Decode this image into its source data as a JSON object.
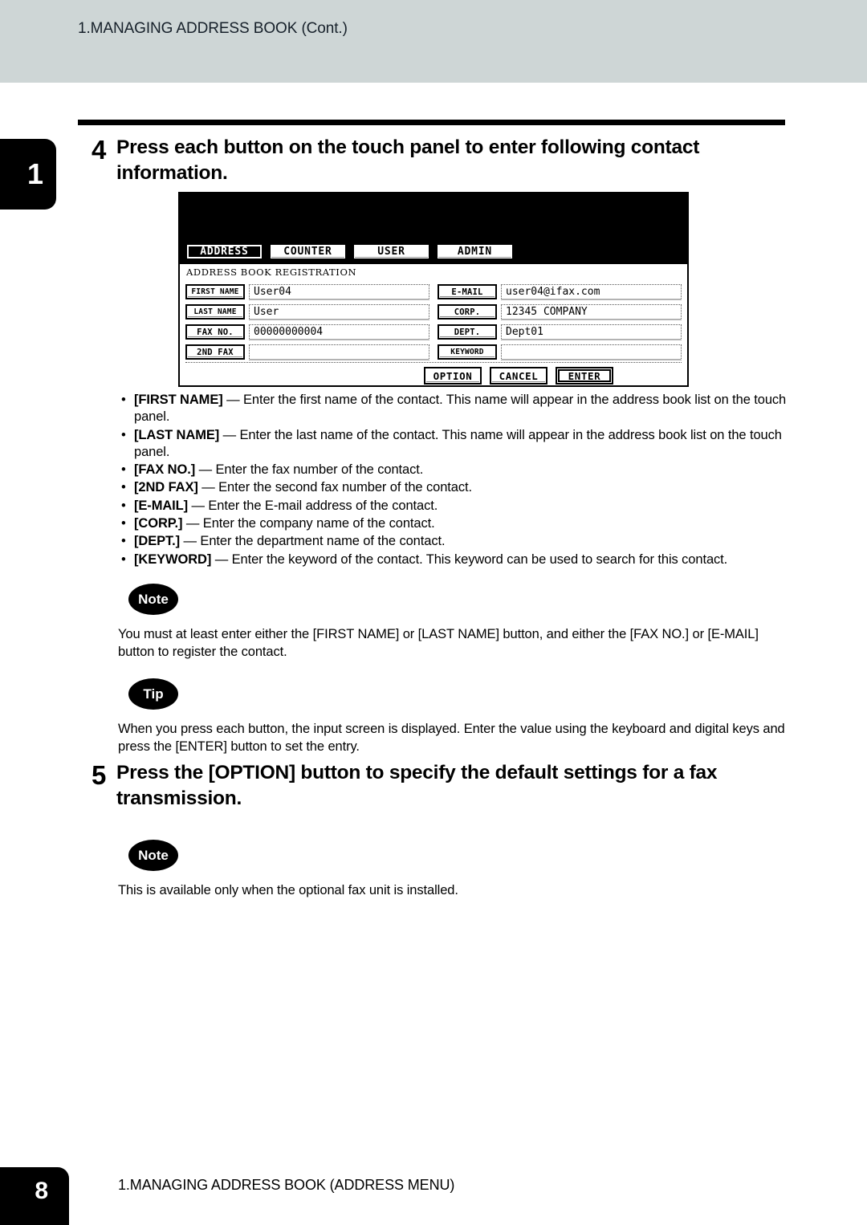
{
  "header": {
    "running_title": "1.MANAGING ADDRESS BOOK (Cont.)"
  },
  "chapter_tab": {
    "number": "1"
  },
  "steps": [
    {
      "number": "4",
      "text": "Press each button on the touch panel to enter following contact information."
    },
    {
      "number": "5",
      "text": "Press the [OPTION] button to specify the default settings for a fax transmission."
    }
  ],
  "touch_panel": {
    "tabs": [
      {
        "label": "ADDRESS",
        "selected": true
      },
      {
        "label": "COUNTER",
        "selected": false
      },
      {
        "label": "USER",
        "selected": false
      },
      {
        "label": "ADMIN",
        "selected": false
      }
    ],
    "screen_title": "ADDRESS BOOK REGISTRATION",
    "fields_left": [
      {
        "key": "FIRST NAME",
        "value": "User04"
      },
      {
        "key": "LAST NAME",
        "value": "User"
      },
      {
        "key": "FAX NO.",
        "value": "00000000004"
      },
      {
        "key": "2ND FAX",
        "value": ""
      }
    ],
    "fields_right": [
      {
        "key": "E-MAIL",
        "value": "user04@ifax.com"
      },
      {
        "key": "CORP.",
        "value": "12345 COMPANY"
      },
      {
        "key": "DEPT.",
        "value": "Dept01"
      },
      {
        "key": "KEYWORD",
        "value": ""
      }
    ],
    "actions": [
      {
        "label": "OPTION",
        "focused": false
      },
      {
        "label": "CANCEL",
        "focused": false
      },
      {
        "label": "ENTER",
        "focused": true
      }
    ]
  },
  "bullets": [
    {
      "term": "[FIRST NAME]",
      "desc": " — Enter the first name of the contact.  This name will appear in the address book list on the touch panel."
    },
    {
      "term": "[LAST NAME]",
      "desc": " — Enter the last name of the contact.  This name will appear in the address book list on the touch panel."
    },
    {
      "term": "[FAX NO.]",
      "desc": " — Enter the fax number of the contact."
    },
    {
      "term": "[2ND FAX]",
      "desc": " — Enter the second fax number of the contact."
    },
    {
      "term": "[E-MAIL]",
      "desc": " — Enter the E-mail address of the contact."
    },
    {
      "term": "[CORP.]",
      "desc": " — Enter the company name of the contact."
    },
    {
      "term": "[DEPT.]",
      "desc": " — Enter the department name of the contact."
    },
    {
      "term": "[KEYWORD]",
      "desc": " — Enter the keyword of the contact.  This keyword can be used to search for this contact."
    }
  ],
  "bullet_marker": "•",
  "callouts": {
    "note1": {
      "badge": "Note",
      "body": "You must at least enter either the [FIRST NAME] or [LAST NAME] button, and either the [FAX NO.] or [E-MAIL] button to register the contact."
    },
    "tip1": {
      "badge": "Tip",
      "body": "When you press each button, the input screen is displayed.  Enter the value using the keyboard and digital keys and press the [ENTER] button to set the entry."
    },
    "note2": {
      "badge": "Note",
      "body": "This is available only when the optional fax unit is installed."
    }
  },
  "footer": {
    "page_number": "8",
    "section_title": "1.MANAGING ADDRESS BOOK (ADDRESS MENU)"
  },
  "colors": {
    "header_band": "#ced6d6",
    "ink": "#000000",
    "paper": "#ffffff"
  }
}
